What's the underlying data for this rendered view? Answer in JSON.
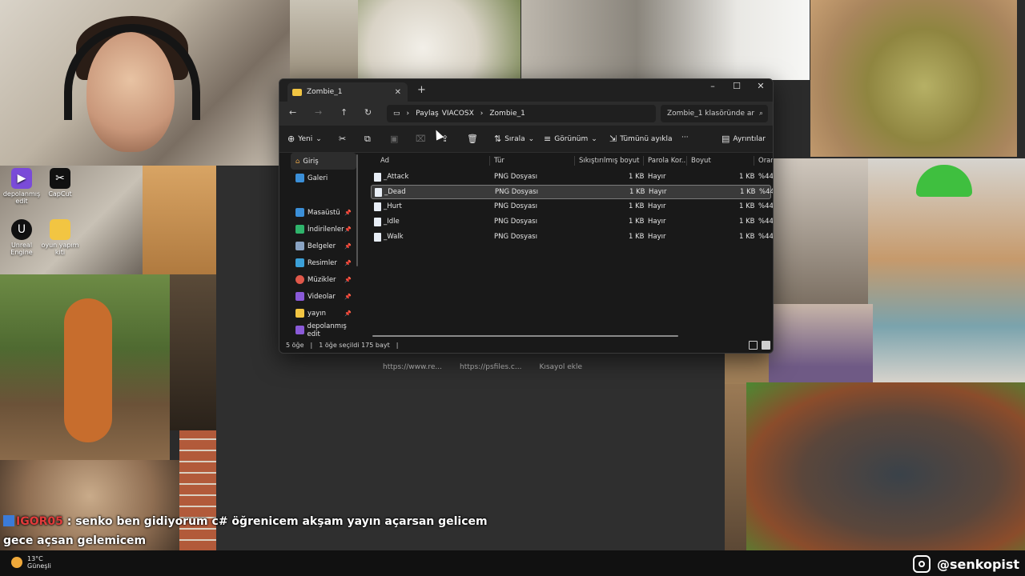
{
  "desktop": {
    "icons": [
      {
        "label": "depolanmış edit",
        "icon": "video-app-icon",
        "color": "#7a4bd8"
      },
      {
        "label": "CapCut",
        "icon": "capcut-icon",
        "color": "#111111"
      },
      {
        "label": "Unreal Engine",
        "icon": "unreal-engine-icon",
        "color": "#111111"
      },
      {
        "label": "oyun yapım kiti",
        "icon": "folder-icon",
        "color": "#f2c542"
      }
    ]
  },
  "browser": {
    "links": [
      "https://www.re...",
      "https://psfiles.c...",
      "Kısayol ekle"
    ]
  },
  "explorer": {
    "tab_title": "Zombie_1",
    "window_controls": {
      "minimize": "–",
      "maximize": "☐",
      "close": "✕"
    },
    "breadcrumb": {
      "share": "Paylaş",
      "parent": "VIACOSX",
      "current": "Zombie_1"
    },
    "search_placeholder": "Zombie_1 klasöründe ar",
    "toolbar": {
      "new": "Yeni",
      "sort": "Sırala",
      "view": "Görünüm",
      "select_all": "Tümünü ayıkla",
      "more": "···",
      "details": "Ayrıntılar"
    },
    "sidebar": {
      "home": "Giriş",
      "gallery": "Galeri",
      "items": [
        {
          "label": "Masaüstü",
          "color": "#3b8fd8"
        },
        {
          "label": "İndirilenler",
          "color": "#2fb36b"
        },
        {
          "label": "Belgeler",
          "color": "#8aa3c2"
        },
        {
          "label": "Resimler",
          "color": "#3ba0d8"
        },
        {
          "label": "Müzikler",
          "color": "#e0584a"
        },
        {
          "label": "Videolar",
          "color": "#8a5ad8"
        },
        {
          "label": "yayın",
          "color": "#f2c542"
        },
        {
          "label": "depolanmış edit",
          "color": "#8a5ad8"
        }
      ]
    },
    "columns": [
      "Ad",
      "Tür",
      "Sıkıştırılmış boyut",
      "Parola Kor...",
      "Boyut",
      "Oran"
    ],
    "files": [
      {
        "name": "_Attack",
        "type": "PNG Dosyası",
        "compressed": "1 KB",
        "password": "Hayır",
        "size": "1 KB",
        "ratio": "%44"
      },
      {
        "name": "_Dead",
        "type": "PNG Dosyası",
        "compressed": "1 KB",
        "password": "Hayır",
        "size": "1 KB",
        "ratio": "%44"
      },
      {
        "name": "_Hurt",
        "type": "PNG Dosyası",
        "compressed": "1 KB",
        "password": "Hayır",
        "size": "1 KB",
        "ratio": "%44"
      },
      {
        "name": "_Idle",
        "type": "PNG Dosyası",
        "compressed": "1 KB",
        "password": "Hayır",
        "size": "1 KB",
        "ratio": "%44"
      },
      {
        "name": "_Walk",
        "type": "PNG Dosyası",
        "compressed": "1 KB",
        "password": "Hayır",
        "size": "1 KB",
        "ratio": "%44"
      }
    ],
    "selected_file": "_Dead",
    "status": {
      "count": "5 öğe",
      "selection": "1 öğe seçildi  175 bayt"
    }
  },
  "chat": {
    "user": "IGOR05",
    "message": ": senko ben gidiyorum c# öğrenicem akşam yayın açarsan gelicem gece açsan gelemicem"
  },
  "weather": {
    "temp": "13°C",
    "condition": "Güneşli"
  },
  "social": {
    "handle": "@senkopist"
  }
}
